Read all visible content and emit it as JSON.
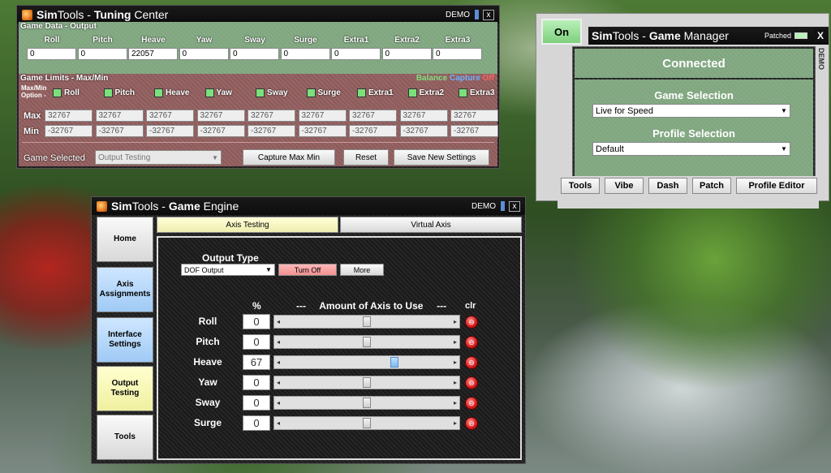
{
  "tuning": {
    "title_bold": "Sim",
    "title_rest": "Tools",
    "title_sep": " - ",
    "title_bold2": "Tuning",
    "title_rest2": " Center",
    "demo": "DEMO",
    "close": "x",
    "game_data_label": "Game Data - Output",
    "columns": [
      "Roll",
      "Pitch",
      "Heave",
      "Yaw",
      "Sway",
      "Surge",
      "Extra1",
      "Extra2",
      "Extra3"
    ],
    "outputs": [
      "0",
      "0",
      "22057",
      "0",
      "0",
      "0",
      "0",
      "0",
      "0"
    ],
    "limits_label": "Game Limits - Max/Min",
    "balance": "Balance",
    "capture": "Capture",
    "off": "Off",
    "option_label": "Max/Min Option -",
    "max_label": "Max",
    "min_label": "Min",
    "max_values": [
      "32767",
      "32767",
      "32767",
      "32767",
      "32767",
      "32767",
      "32767",
      "32767",
      "32767"
    ],
    "min_values": [
      "-32767",
      "-32767",
      "-32767",
      "-32767",
      "-32767",
      "-32767",
      "-32767",
      "-32767",
      "-32767"
    ],
    "game_selected_label": "Game Selected",
    "game_selected_value": "Output Testing",
    "capture_btn": "Capture Max Min",
    "reset_btn": "Reset",
    "save_btn": "Save New Settings"
  },
  "manager": {
    "on_btn": "On",
    "title_bold": "Sim",
    "title_rest": "Tools",
    "title_sep": " - ",
    "title_bold2": "Game",
    "title_rest2": " Manager",
    "patched": "Patched",
    "close": "X",
    "demo_vertical": "DEMO",
    "status": "Connected",
    "game_selection_label": "Game Selection",
    "game_selection_value": "Live for Speed",
    "profile_selection_label": "Profile Selection",
    "profile_selection_value": "Default",
    "buttons": [
      "Tools",
      "Vibe",
      "Dash",
      "Patch",
      "Profile Editor"
    ]
  },
  "engine": {
    "title_bold": "Sim",
    "title_rest": "Tools",
    "title_sep": " - ",
    "title_bold2": "Game",
    "title_rest2": " Engine",
    "demo": "DEMO",
    "close": "x",
    "nav": [
      "Home",
      "Axis Assignments",
      "Interface Settings",
      "Output Testing",
      "Tools"
    ],
    "tabs": [
      "Axis Testing",
      "Virtual Axis"
    ],
    "output_type_label": "Output Type",
    "output_type_value": "DOF Output",
    "turn_off_btn": "Turn Off",
    "more_btn": "More",
    "pct_header": "%",
    "amount_header": "---     Amount of Axis to Use     ---",
    "clr_header": "clr",
    "axes": [
      {
        "name": "Roll",
        "value": "0",
        "level": 0.5
      },
      {
        "name": "Pitch",
        "value": "0",
        "level": 0.5
      },
      {
        "name": "Heave",
        "value": "67",
        "level": 0.67
      },
      {
        "name": "Yaw",
        "value": "0",
        "level": 0.5
      },
      {
        "name": "Sway",
        "value": "0",
        "level": 0.5
      },
      {
        "name": "Surge",
        "value": "0",
        "level": 0.5
      }
    ]
  },
  "colors": {
    "green_section": "#7fa67f",
    "red_section": "#8e5a5a",
    "balance_color": "#7fe07f",
    "capture_color": "#6fb0ff",
    "off_color": "#ff6060",
    "clear_button": "#d81c1c"
  }
}
